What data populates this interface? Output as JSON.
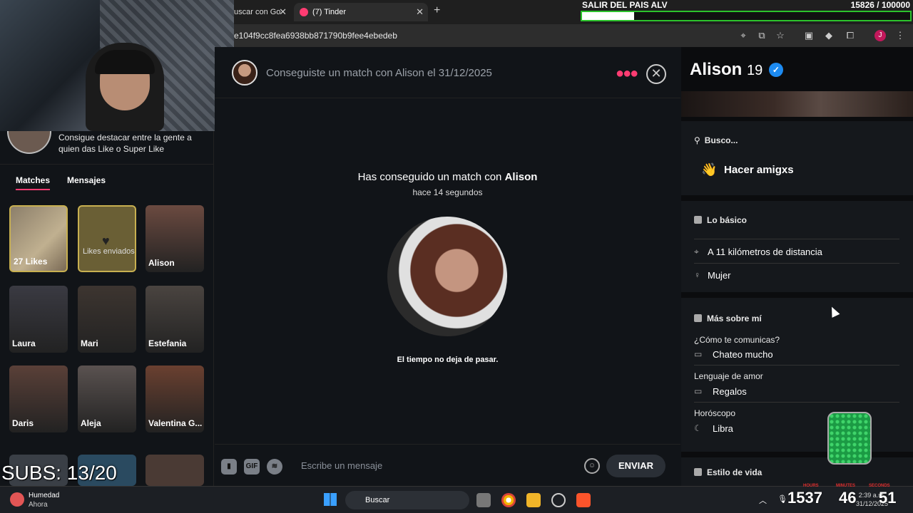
{
  "browser": {
    "tabs": [
      {
        "label": "uscar con Go"
      },
      {
        "label": "(7) Tinder"
      }
    ],
    "url": "e104f9cc8fea6938bb871790b9fee4ebedeb"
  },
  "overlay": {
    "goal_title": "SALIR DEL PAIS ALV",
    "goal_count": "15826 / 100000",
    "goal_progress": 0.158,
    "subs": "SUBS: 13/20"
  },
  "sidebar": {
    "promo_text": "Consigue destacar entre la gente a quien das Like o Super Like",
    "tabs": [
      "Matches",
      "Mensajes"
    ],
    "cards": [
      {
        "name": "27 Likes",
        "kind": "likes"
      },
      {
        "name": "Likes enviados",
        "kind": "sent"
      },
      {
        "name": "Alison",
        "kind": "profile",
        "color": "#6b4a40"
      },
      {
        "name": "Laura",
        "kind": "profile",
        "color": "#3a3a42"
      },
      {
        "name": "Mari",
        "kind": "profile",
        "color": "#3d3530"
      },
      {
        "name": "Estefania",
        "kind": "profile",
        "color": "#4a4440"
      },
      {
        "name": "Daris",
        "kind": "profile",
        "color": "#5a4038"
      },
      {
        "name": "Aleja",
        "kind": "profile",
        "color": "#5a5250"
      },
      {
        "name": "Valentina G...",
        "kind": "profile",
        "color": "#6a4030"
      }
    ]
  },
  "chat": {
    "header_title": "Conseguiste un match con Alison el 31/12/2025",
    "match_prefix": "Has conseguido un match con ",
    "match_name": "Alison",
    "match_time": "hace 14 segundos",
    "bio": "El tiempo no deja de pasar.",
    "composer_placeholder": "Escribe un mensaje",
    "gif_label": "GIF",
    "send_label": "ENVIAR"
  },
  "profile": {
    "name": "Alison",
    "age": "19",
    "looking_header": "Busco...",
    "looking_value": "Hacer amigxs",
    "basics_header": "Lo básico",
    "distance": "A 11 kilómetros de distancia",
    "gender": "Mujer",
    "more_header": "Más sobre mí",
    "comm_q": "¿Cómo te comunicas?",
    "comm_a": "Chateo mucho",
    "love_q": "Lenguaje de amor",
    "love_a": "Regalos",
    "horo_q": "Horóscopo",
    "horo_a": "Libra",
    "lifestyle_header": "Estilo de vida"
  },
  "taskbar": {
    "weather_title": "Humedad",
    "weather_sub": "Ahora",
    "search_label": "Buscar",
    "clock_time": "2:39 a.m.",
    "clock_date": "31/12/2025",
    "timer_hours": "1537",
    "timer_minutes": "46",
    "timer_seconds": "51",
    "timer_hours_label": "HOURS",
    "timer_minutes_label": "MINUTES",
    "timer_seconds_label": "SECONDS"
  }
}
